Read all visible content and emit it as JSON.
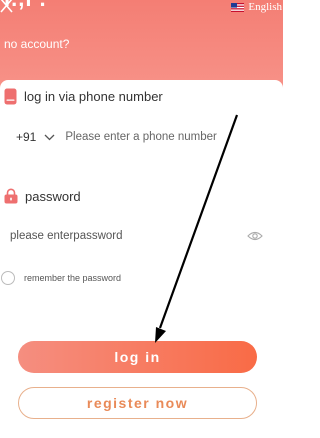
{
  "header": {
    "title_fragment": "ı.,ı .",
    "no_account_text": "no account?",
    "language_label": "English"
  },
  "phone": {
    "section_label": "log in via phone number",
    "country_code": "+91",
    "placeholder": "Please enter a phone number"
  },
  "password": {
    "section_label": "password",
    "placeholder": "please enterpassword"
  },
  "remember": {
    "label": "remember the password"
  },
  "buttons": {
    "login_label": "log in",
    "register_label": "register now"
  },
  "colors": {
    "header": "#f58a80",
    "accent": "#f96b46",
    "register_text": "#e98a58"
  },
  "icons": {
    "back": "close-icon",
    "flag": "us-flag-icon",
    "phone": "phone-icon",
    "dropdown": "chevron-down-icon",
    "lock": "lock-icon",
    "visibility": "eye-icon",
    "annotation": "arrow-icon"
  }
}
